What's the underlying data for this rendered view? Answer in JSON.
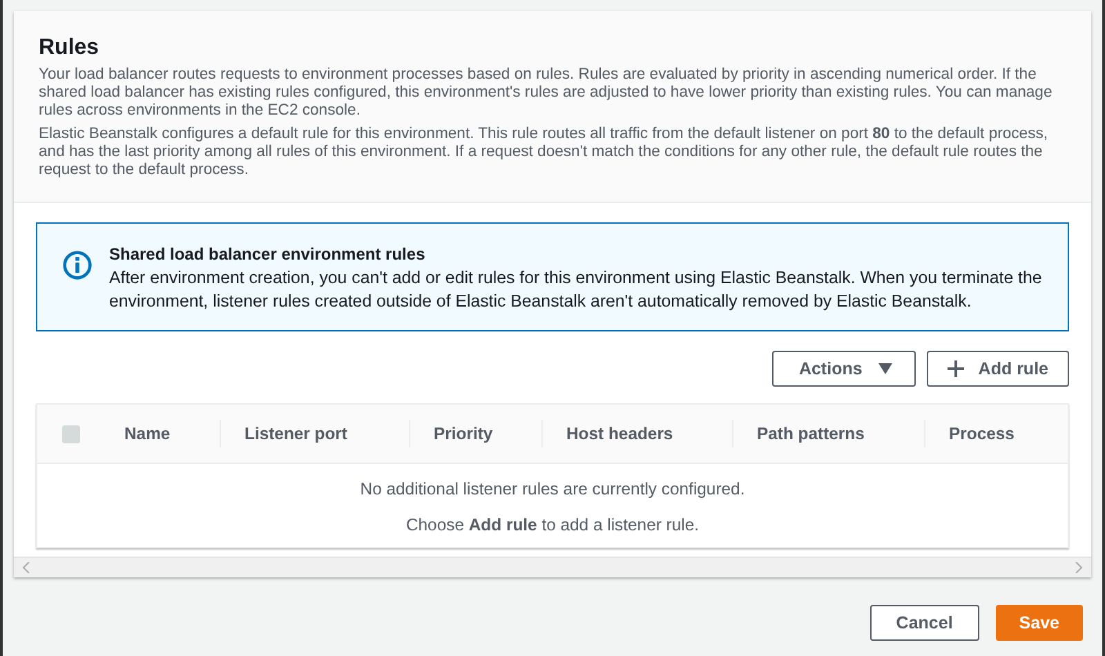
{
  "panel": {
    "title": "Rules",
    "paragraphs": [
      "Your load balancer routes requests to environment processes based on rules. Rules are evaluated by priority in ascending numerical order. If the shared load balancer has existing rules configured, this environment's rules are adjusted to have lower priority than existing rules. You can manage rules across environments in the EC2 console.",
      "Elastic Beanstalk configures a default rule for this environment. This rule routes all traffic from the default listener on port **80** to the default process, and has the last priority among all rules of this environment. If a request doesn't match the conditions for any other rule, the default rule routes the request to the default process."
    ]
  },
  "info": {
    "title": "Shared load balancer environment rules",
    "text": "After environment creation, you can't add or edit rules for this environment using Elastic Beanstalk. When you terminate the environment, listener rules created outside of Elastic Beanstalk aren't automatically removed by Elastic Beanstalk."
  },
  "toolbar": {
    "actions": "Actions",
    "add": "Add rule"
  },
  "table": {
    "select_all": {
      "checked": false,
      "disabled": true
    },
    "columns": [
      "Name",
      "Listener port",
      "Priority",
      "Host headers",
      "Path patterns",
      "Process"
    ],
    "empty": "No additional listener rules are currently configured.",
    "hint": "Choose **Add rule** to add a listener rule."
  },
  "buttons": [
    {
      "label": "Cancel",
      "kind": "secondary"
    },
    {
      "label": "Save",
      "kind": "primary"
    }
  ]
}
